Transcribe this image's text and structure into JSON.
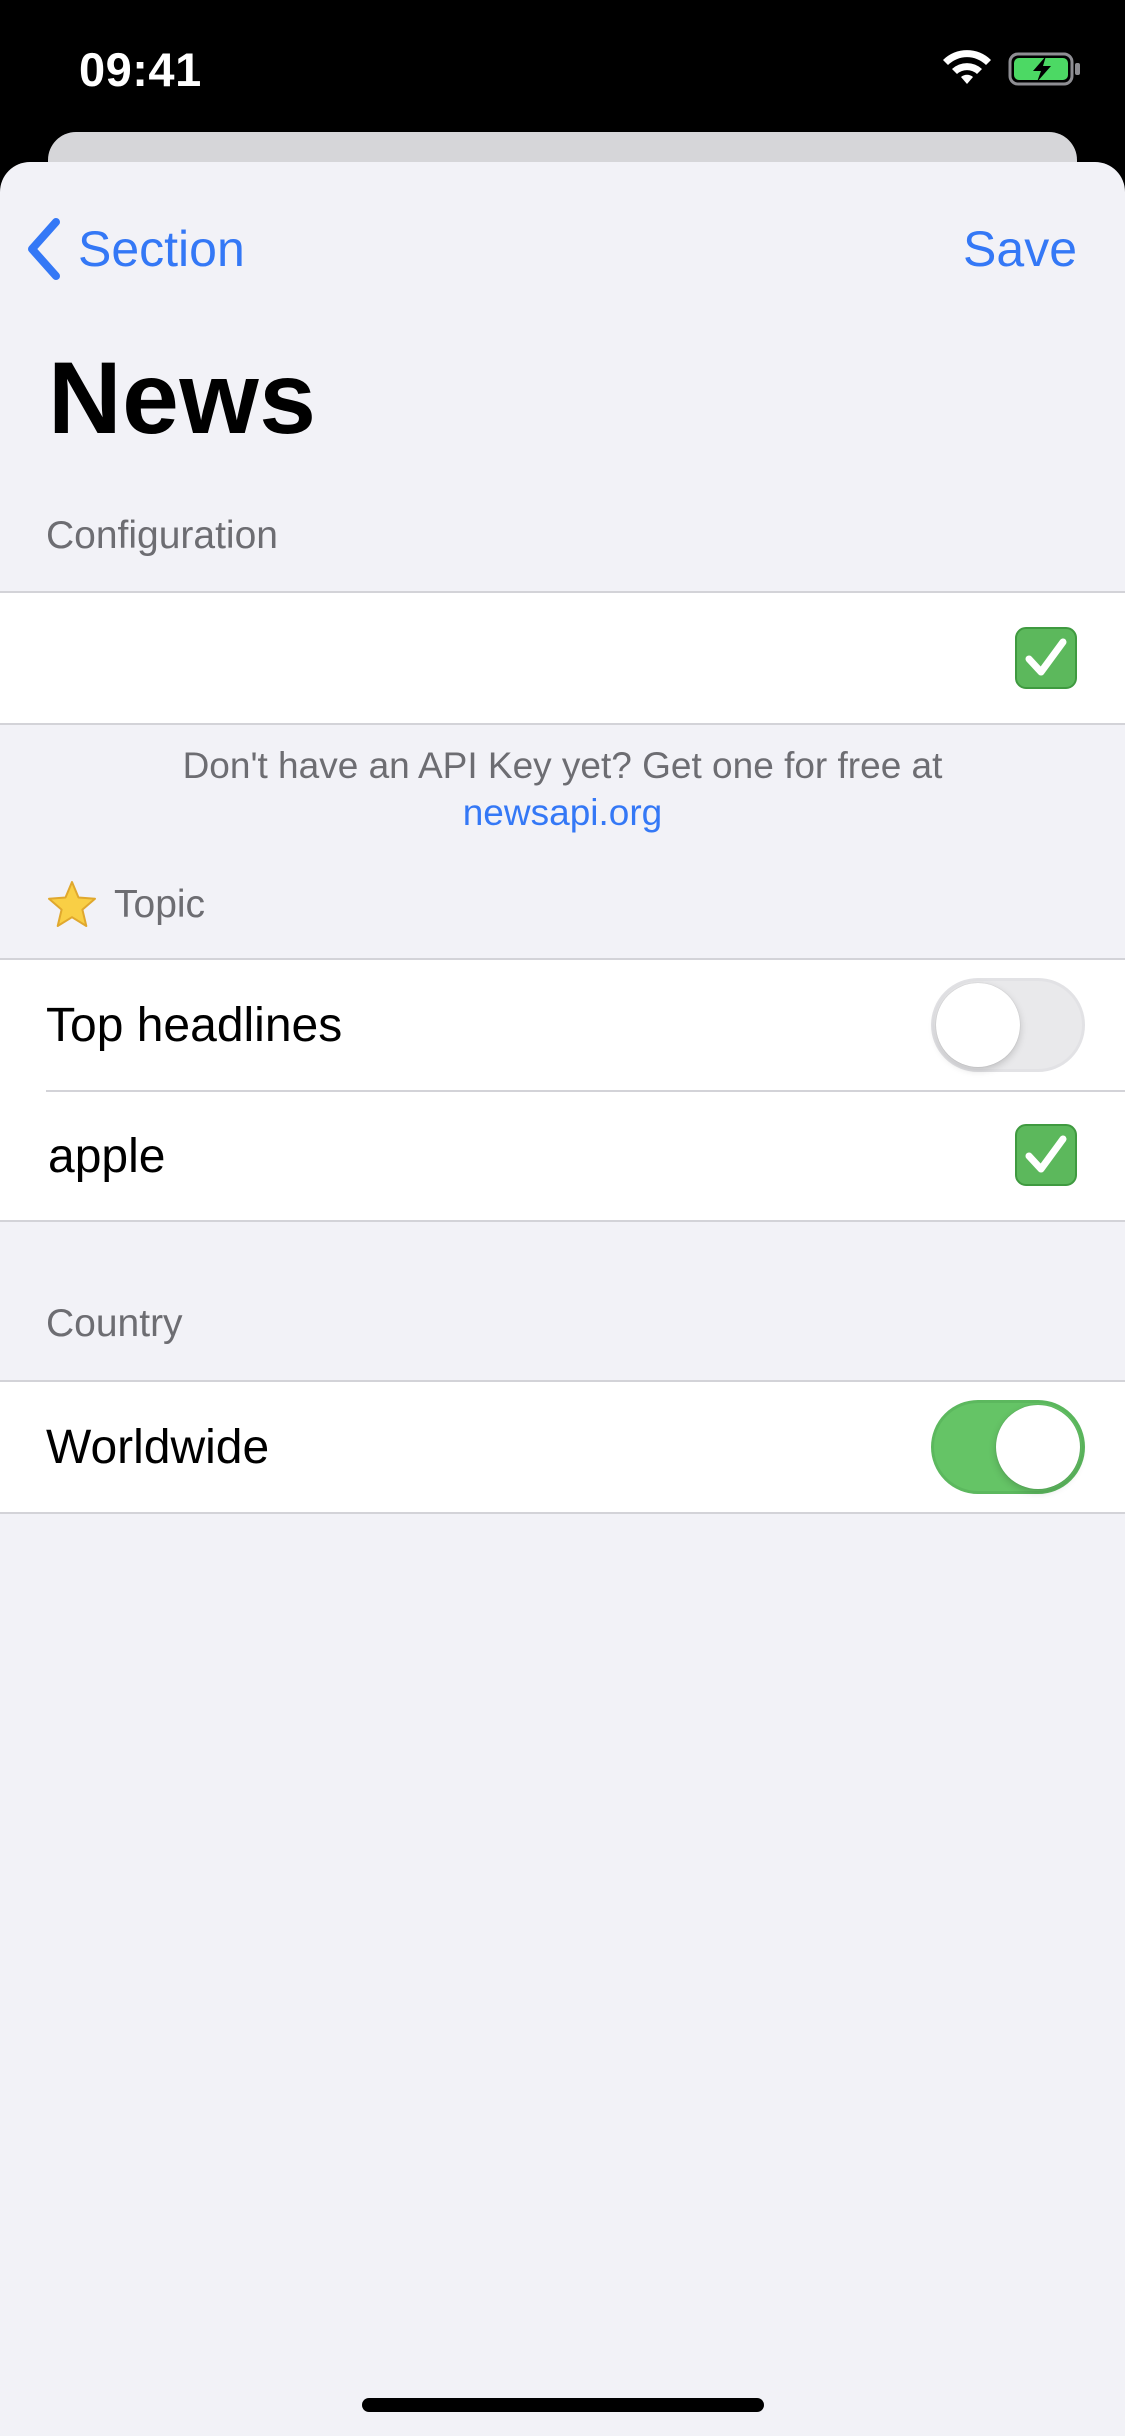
{
  "status_bar": {
    "time": "09:41"
  },
  "nav": {
    "back_label": "Section",
    "save_label": "Save"
  },
  "title": "News",
  "configuration": {
    "header": "Configuration",
    "api_key_value": "",
    "footer_text": "Don't have an API Key yet? Get one for free at",
    "footer_link": "newsapi.org"
  },
  "topic": {
    "header": "Topic",
    "top_headlines_label": "Top headlines",
    "top_headlines_on": false,
    "query_value": "apple"
  },
  "country": {
    "header": "Country",
    "worldwide_label": "Worldwide",
    "worldwide_on": true
  },
  "colors": {
    "accent": "#3478f6",
    "toggle_on": "#65c466",
    "check": "#5cb85c",
    "background": "#f2f2f7"
  },
  "icons": [
    "wifi-icon",
    "battery-charging-icon",
    "chevron-left-icon",
    "check-mark-icon",
    "star-icon"
  ]
}
